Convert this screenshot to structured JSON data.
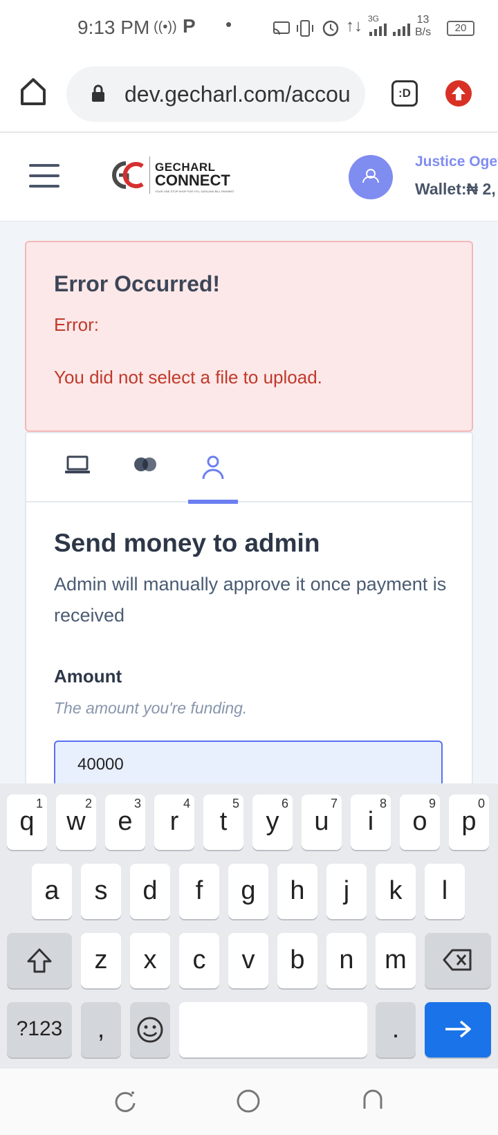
{
  "status_bar": {
    "time": "9:13 PM",
    "network_type": "3G",
    "speed_value": "13",
    "speed_unit": "B/s",
    "battery": "20"
  },
  "browser": {
    "url": "dev.gecharl.com/accou",
    "tab_icon_label": ":D"
  },
  "header": {
    "logo_line1": "GECHARL",
    "logo_line2": "CONNECT",
    "logo_tagline": "YOUR ONE STOP SHOP FOR VTU, DATA AND BILL PAYMENT",
    "user_name": "Justice Ogey",
    "wallet": "Wallet:₦ 2,"
  },
  "alert": {
    "title": "Error Occurred!",
    "label": "Error:",
    "message": "You did not select a file to upload."
  },
  "tabs": [
    {
      "icon": "laptop-icon"
    },
    {
      "icon": "mastercard-icon"
    },
    {
      "icon": "user-icon",
      "active": true
    }
  ],
  "form": {
    "title": "Send money to admin",
    "description": "Admin will manually approve it once payment is received",
    "amount_label": "Amount",
    "amount_hint": "The amount you're funding.",
    "amount_value": "40000"
  },
  "keyboard": {
    "row1": [
      "q",
      "w",
      "e",
      "r",
      "t",
      "y",
      "u",
      "i",
      "o",
      "p"
    ],
    "row1_hints": [
      "1",
      "2",
      "3",
      "4",
      "5",
      "6",
      "7",
      "8",
      "9",
      "0"
    ],
    "row2": [
      "a",
      "s",
      "d",
      "f",
      "g",
      "h",
      "j",
      "k",
      "l"
    ],
    "row3": [
      "z",
      "x",
      "c",
      "v",
      "b",
      "n",
      "m"
    ],
    "sym_key": "?123",
    "comma": ",",
    "period": ".",
    "enter_icon": "arrow-right-icon"
  },
  "colors": {
    "accent": "#6b7ff0",
    "error_text": "#c0392b",
    "error_bg": "#fce8e8",
    "enter_key": "#1a73e8"
  }
}
